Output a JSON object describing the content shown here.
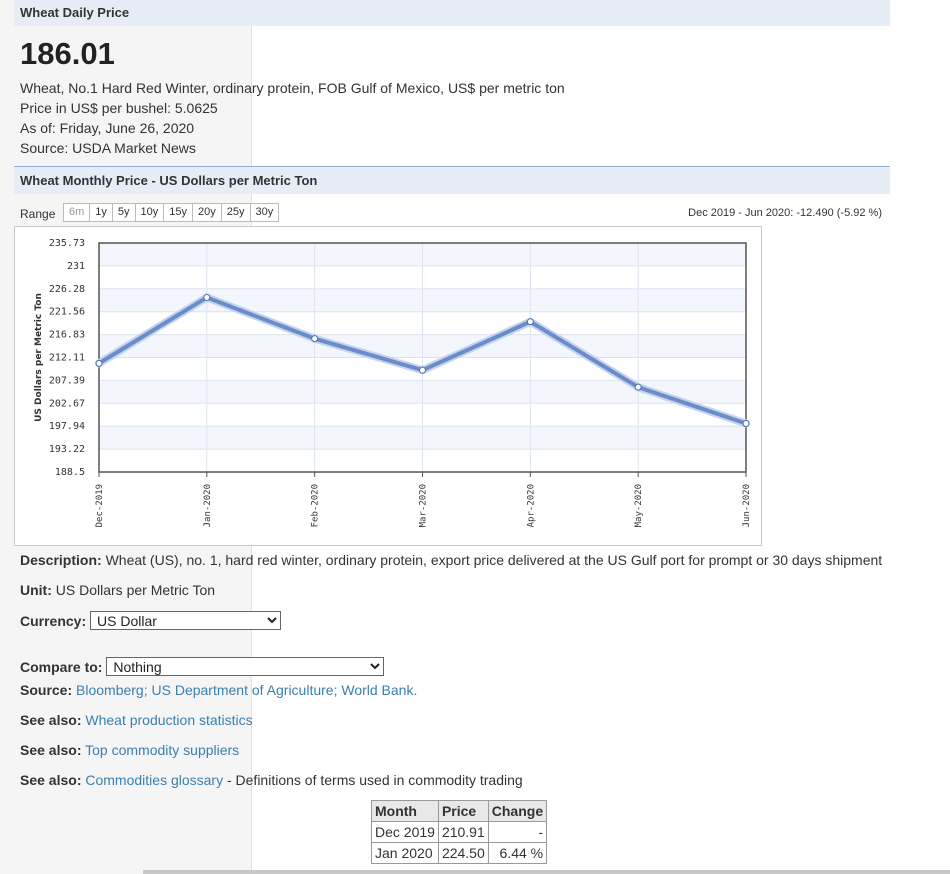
{
  "daily": {
    "header": "Wheat Daily Price",
    "price": "186.01",
    "lines": [
      "Wheat, No.1 Hard Red Winter, ordinary protein, FOB Gulf of Mexico, US$ per metric ton",
      "Price in US$ per bushel: 5.0625",
      "As of: Friday, June 26, 2020",
      "Source: USDA Market News"
    ]
  },
  "monthly": {
    "header": "Wheat Monthly Price - US Dollars per Metric Ton",
    "range_label": "Range",
    "range_buttons": [
      "6m",
      "1y",
      "5y",
      "10y",
      "15y",
      "20y",
      "25y",
      "30y"
    ],
    "active_range": "6m",
    "summary": "Dec 2019 - Jun 2020: -12.490 (-5.92 %)"
  },
  "chart_data": {
    "type": "line",
    "ylabel": "US Dollars per Metric Ton",
    "categories": [
      "Dec-2019",
      "Jan-2020",
      "Feb-2020",
      "Mar-2020",
      "Apr-2020",
      "May-2020",
      "Jun-2020"
    ],
    "values": [
      210.91,
      224.5,
      216.0,
      209.5,
      219.5,
      206.0,
      198.5
    ],
    "yticks": [
      "235.73",
      "231",
      "226.28",
      "221.56",
      "216.83",
      "212.11",
      "207.39",
      "202.67",
      "197.94",
      "193.22",
      "188.5"
    ],
    "ylim": [
      188.5,
      235.73
    ],
    "grid": true,
    "line_color": "#6a8cc8"
  },
  "fields": {
    "description_label": "Description:",
    "description": "Wheat (US), no. 1, hard red winter, ordinary protein, export price delivered at the US Gulf port for prompt or 30 days shipment",
    "unit_label": "Unit:",
    "unit": "US Dollars per Metric Ton",
    "currency_label": "Currency:",
    "currency_value": "US Dollar",
    "compare_label": "Compare to:",
    "compare_value": "Nothing",
    "source_label": "Source:",
    "source_link": "Bloomberg; US Department of Agriculture; World Bank.",
    "see_also_label": "See also:",
    "see_also_1": "Wheat production statistics",
    "see_also_2": "Top commodity suppliers",
    "see_also_3": "Commodities glossary",
    "see_also_3_suffix": " - Definitions of terms used in commodity trading"
  },
  "table": {
    "headers": [
      "Month",
      "Price",
      "Change"
    ],
    "rows": [
      [
        "Dec 2019",
        "210.91",
        "-"
      ],
      [
        "Jan 2020",
        "224.50",
        "6.44 %"
      ]
    ]
  }
}
